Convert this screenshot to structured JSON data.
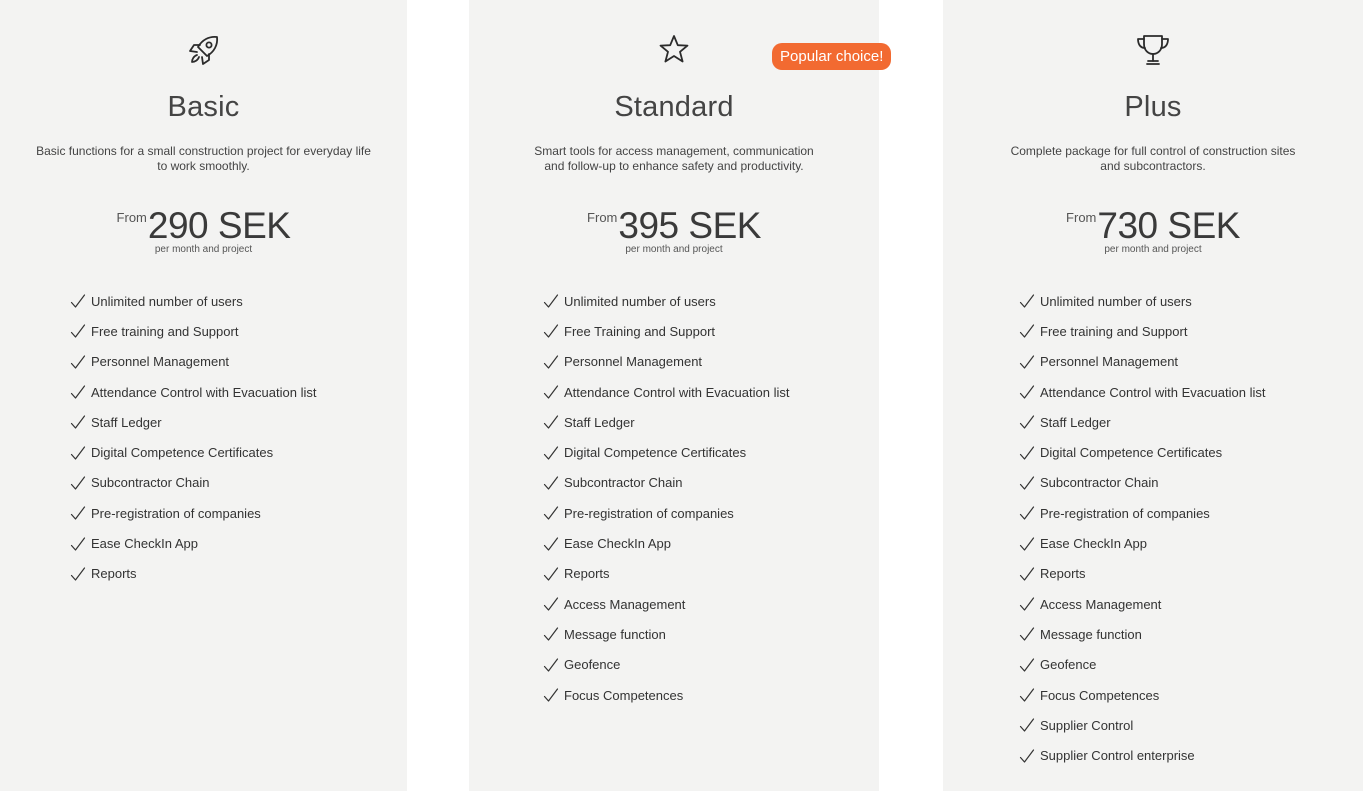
{
  "colors": {
    "card_background": "#f3f3f2",
    "badge_background": "#f26a31",
    "badge_text": "#ffffff",
    "text": "#333333"
  },
  "badge": {
    "label": "Popular choice!"
  },
  "plans": {
    "basic": {
      "icon": "rocket-icon",
      "title": "Basic",
      "description_lines": [
        "Basic functions for a small construction project for everyday life",
        "to work smoothly."
      ],
      "price_prefix": "From",
      "price": "290 SEK",
      "price_note": "per month and project",
      "features": [
        "Unlimited number of users",
        "Free training and Support",
        "Personnel Management",
        "Attendance Control with Evacuation list",
        "Staff Ledger",
        "Digital Competence Certificates",
        "Subcontractor Chain",
        "Pre-registration of companies",
        "Ease CheckIn App",
        "Reports"
      ]
    },
    "standard": {
      "icon": "star-icon",
      "title": "Standard",
      "description_lines": [
        "Smart tools for access management, communication",
        "and follow-up to enhance safety and productivity."
      ],
      "price_prefix": "From",
      "price": "395 SEK",
      "price_note": "per month and project",
      "features": [
        "Unlimited number of users",
        "Free Training and Support",
        "Personnel Management",
        "Attendance Control with Evacuation list",
        "Staff Ledger",
        "Digital Competence Certificates",
        "Subcontractor Chain",
        "Pre-registration of companies",
        "Ease CheckIn App",
        "Reports",
        "Access Management",
        "Message function",
        "Geofence",
        "Focus Competences"
      ]
    },
    "plus": {
      "icon": "trophy-icon",
      "title": "Plus",
      "description_lines": [
        "Complete package for full control of construction sites",
        "and subcontractors."
      ],
      "price_prefix": "From",
      "price": "730 SEK",
      "price_note": "per month and project",
      "features": [
        "Unlimited number of users",
        "Free training and Support",
        "Personnel Management",
        "Attendance Control with Evacuation list",
        "Staff Ledger",
        "Digital Competence Certificates",
        "Subcontractor Chain",
        "Pre-registration of companies",
        "Ease CheckIn App",
        "Reports",
        "Access Management",
        "Message function",
        "Geofence",
        "Focus Competences",
        "Supplier Control",
        "Supplier Control enterprise"
      ]
    }
  }
}
